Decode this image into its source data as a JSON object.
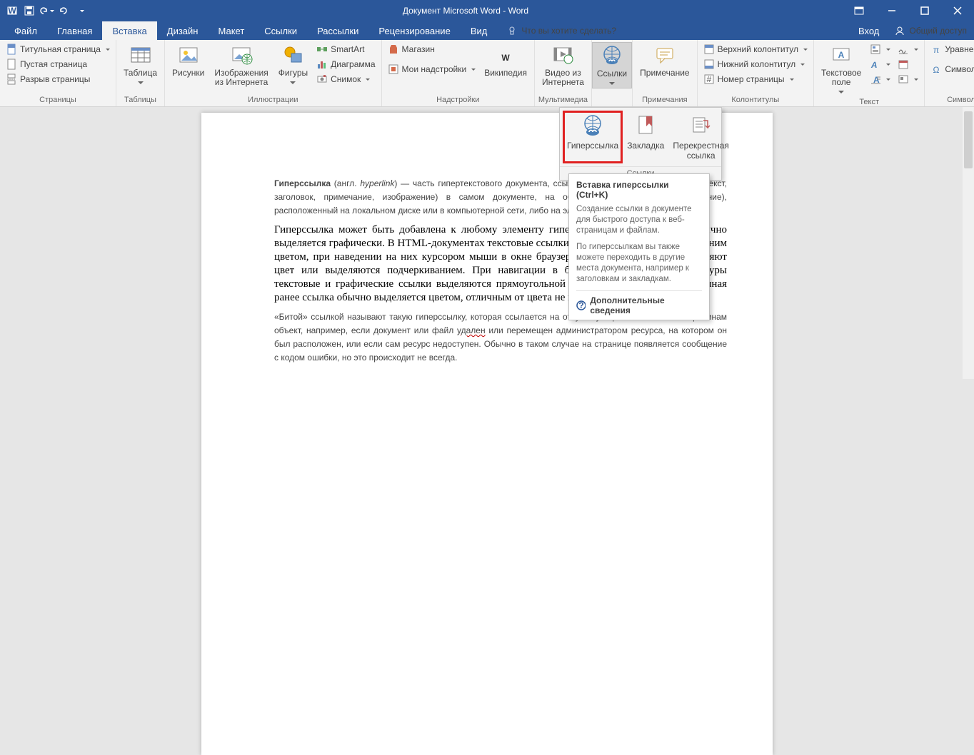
{
  "titlebar": {
    "title": "Документ Microsoft Word - Word"
  },
  "tabs": {
    "file": "Файл",
    "home": "Главная",
    "insert": "Вставка",
    "design": "Дизайн",
    "layout": "Макет",
    "references": "Ссылки",
    "mailings": "Рассылки",
    "review": "Рецензирование",
    "view": "Вид",
    "tellme": "Что вы хотите сделать?",
    "login": "Вход",
    "share": "Общий доступ"
  },
  "ribbon": {
    "pages": {
      "cover": "Титульная страница",
      "blank": "Пустая страница",
      "break": "Разрыв страницы",
      "label": "Страницы"
    },
    "tables": {
      "table": "Таблица",
      "label": "Таблицы"
    },
    "illustrations": {
      "pictures": "Рисунки",
      "online": "Изображения\nиз Интернета",
      "shapes": "Фигуры",
      "smartart": "SmartArt",
      "chart": "Диаграмма",
      "screenshot": "Снимок",
      "label": "Иллюстрации"
    },
    "addins": {
      "store": "Магазин",
      "my": "Мои надстройки",
      "wiki": "Википедия",
      "label": "Надстройки"
    },
    "media": {
      "video": "Видео из\nИнтернета",
      "label": "Мультимедиа"
    },
    "links": {
      "links": "Ссылки",
      "label": "Ссылки"
    },
    "comments": {
      "comment": "Примечание",
      "label": "Примечания"
    },
    "header": {
      "header": "Верхний колонтитул",
      "footer": "Нижний колонтитул",
      "page": "Номер страницы",
      "label": "Колонтитулы"
    },
    "text": {
      "textbox": "Текстовое\nполе",
      "label": "Текст"
    },
    "symbols": {
      "equation": "Уравнение",
      "symbol": "Символ",
      "label": "Символы"
    }
  },
  "dropdown": {
    "hyperlink": "Гиперссылка",
    "bookmark": "Закладка",
    "crossref": "Перекрестная\nссылка",
    "label": "Ссылки"
  },
  "tooltip": {
    "title": "Вставка гиперссылки (Ctrl+K)",
    "body1": "Создание ссылки в документе для быстрого доступа к веб-страницам и файлам.",
    "body2": "По гиперссылкам вы также можете переходить в другие места документа, например к заголовкам и закладкам.",
    "more": "Дополнительные сведения"
  },
  "doc": {
    "p1a": "Гиперссылка",
    "p1b": " (англ. ",
    "p1c": "hyperlink",
    "p1d": ") — часть гипертекстового документа, ссылающаяся на элемент (команда, текст, заголовок, примечание, изображение) в самом документе, на объект (файл, каталог, приложение), расположенный на локальном диске или в компьютерной сети, либо на элементы этого объекта.",
    "p2": "Гиперссылка может быть добавлена к любому элементу гипертекстового документа и обычно выделяется графически. В HTML-документах текстовые ссылки по умолчанию выделяются синим цветом, при наведении на них курсором мыши в окне браузера изменяются, например, меняют цвет или выделяются подчеркиванием. При навигации в браузере с помощью клавиатуры текстовые и графические ссылки выделяются прямоугольной пунктирной рамкой. Посещенная ранее ссылка обычно выделяется цветом, отличным от цвета не посещённой ссылки.",
    "p3a": "«Битой» ссылкой называют такую гиперссылку, которая ссылается на отсутствующий по каким-либо причинам объект, например, если документ или файл ",
    "p3b": "удален",
    "p3c": " или перемещен администратором ресурса, на котором он был расположен, или если сам ресурс недоступен. Обычно в таком случае на странице появляется сообщение с кодом ошибки, но это происходит не всегда."
  }
}
